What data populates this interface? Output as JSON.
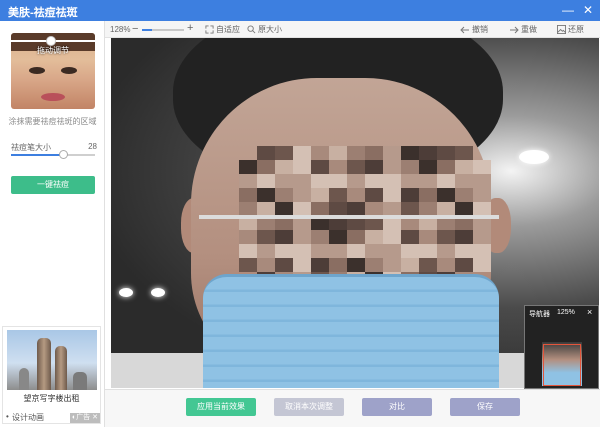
{
  "window": {
    "title": "美肤-祛痘祛斑",
    "minimize_icon": "minimize-icon",
    "close_icon": "close-icon"
  },
  "toolbar": {
    "zoom_percent": "128%",
    "zoom_out_label": "−",
    "zoom_in_label": "+",
    "fit_label": "自适应",
    "actual_size_label": "原大小",
    "undo_label": "撤销",
    "redo_label": "重做",
    "restore_label": "还原",
    "zoom_slider_fraction": 0.24
  },
  "left_panel": {
    "thumbnail_label": "拖动调节",
    "hint": "涂抹需要祛痘祛斑的区域",
    "brush_size_label": "祛痘笔大小",
    "brush_size_value": "28",
    "brush_size_fraction": 0.62,
    "one_click_button": "一键祛痘"
  },
  "ad": {
    "caption": "望京写字楼出租",
    "link": "设计动画",
    "badge": "◐广告 ✕"
  },
  "navigator": {
    "title": "导航器",
    "zoom": "125%",
    "close": "×"
  },
  "bottom_buttons": {
    "apply": "应用当前效果",
    "cancel": "取消本次调整",
    "compare": "对比",
    "save": "保存"
  },
  "colors": {
    "titlebar": "#3d7fe0",
    "primary_green": "#3dbd8a",
    "apply_green": "#43c793",
    "disabled_gray": "#c4c6d4",
    "compare_purple": "#9ea2c9",
    "save_purple": "#9ea2c9"
  }
}
